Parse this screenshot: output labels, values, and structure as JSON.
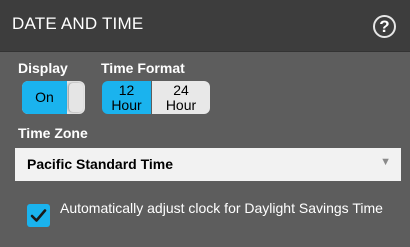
{
  "header": {
    "title": "DATE AND TIME",
    "help_icon": "?"
  },
  "display": {
    "label": "Display",
    "toggle_state": "On"
  },
  "time_format": {
    "label": "Time Format",
    "options": [
      {
        "line1": "12",
        "line2": "Hour",
        "selected": true
      },
      {
        "line1": "24",
        "line2": "Hour",
        "selected": false
      }
    ]
  },
  "time_zone": {
    "label": "Time Zone",
    "selected": "Pacific Standard Time"
  },
  "dst": {
    "label": "Automatically adjust clock for Daylight Savings Time",
    "checked": true
  },
  "colors": {
    "accent": "#1ab3ee",
    "header_bg": "#3d3d3d",
    "panel_bg": "#5d5d5d"
  }
}
